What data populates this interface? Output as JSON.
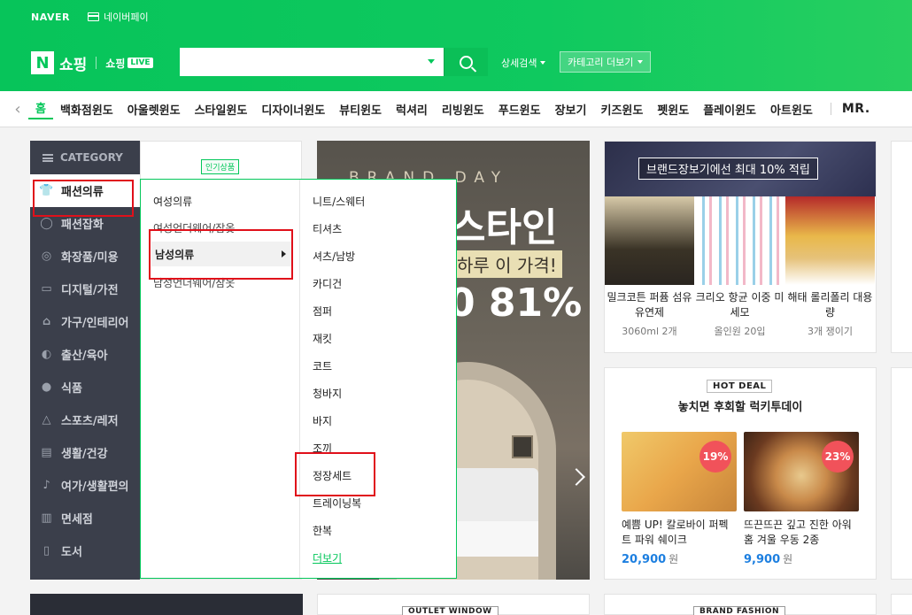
{
  "topbar": {
    "naver": "NAVER",
    "npay": "네이버페이"
  },
  "logo": {
    "n": "N",
    "shop": "쇼핑",
    "shoplive": "쇼핑",
    "live": "LIVE"
  },
  "search": {
    "value": "",
    "button": "search"
  },
  "header_links": {
    "detail": "상세검색",
    "category_more": "카테고리 더보기"
  },
  "nav": {
    "items": [
      "홈",
      "백화점윈도",
      "아울렛윈도",
      "스타일윈도",
      "디자이너윈도",
      "뷰티윈도",
      "럭셔리",
      "리빙윈도",
      "푸드윈도",
      "장보기",
      "키즈윈도",
      "펫윈도",
      "플레이윈도",
      "아트윈도"
    ],
    "mr": "MR."
  },
  "category": {
    "header": "CATEGORY",
    "items": [
      {
        "label": "패션의류",
        "icon": "shirt-icon"
      },
      {
        "label": "패션잡화",
        "icon": "ring-icon"
      },
      {
        "label": "화장품/미용",
        "icon": "mirror-icon"
      },
      {
        "label": "디지털/가전",
        "icon": "monitor-icon"
      },
      {
        "label": "가구/인테리어",
        "icon": "lamp-icon"
      },
      {
        "label": "출산/육아",
        "icon": "duck-icon"
      },
      {
        "label": "식품",
        "icon": "apple-icon"
      },
      {
        "label": "스포츠/레저",
        "icon": "tent-icon"
      },
      {
        "label": "생활/건강",
        "icon": "basket-icon"
      },
      {
        "label": "여가/생활편의",
        "icon": "guitar-icon"
      },
      {
        "label": "면세점",
        "icon": "building-icon"
      },
      {
        "label": "도서",
        "icon": "book-icon"
      }
    ]
  },
  "subpanel": {
    "badge": "인기상품"
  },
  "flyout": {
    "left": [
      "여성의류",
      "여성언더웨어/잠옷",
      "남성의류",
      "남성언더웨어/잠옷"
    ],
    "right": [
      "니트/스웨터",
      "티셔츠",
      "셔츠/남방",
      "카디건",
      "점퍼",
      "재킷",
      "코트",
      "청바지",
      "바지",
      "조끼",
      "정장세트",
      "트레이닝복",
      "한복"
    ],
    "more": "더보기"
  },
  "banner": {
    "brand_day": "BRAND DAY",
    "title": "스타인",
    "tagline": "하루 이 가격!",
    "pct": "0 81%"
  },
  "brand_card": {
    "caption": "브랜드장보기에선 최대 10% 적립",
    "products": [
      {
        "name": "밀크코튼 퍼퓸 섬유유연제",
        "sub": "3060ml 2개"
      },
      {
        "name": "크리오 항균 이중 미세모",
        "sub": "올인원 20입"
      },
      {
        "name": "해태 롤리폴리 대용량",
        "sub": "3개 쟁이기"
      }
    ]
  },
  "deal_card": {
    "badge": "HOT DEAL",
    "title": "놓치면 후회할 럭키투데이",
    "deals": [
      {
        "name": "예쁨 UP! 칼로바이 퍼펙트 파워 쉐이크",
        "price": "20,900",
        "unit": "원",
        "pct": "19%"
      },
      {
        "name": "뜨끈뜨끈 깊고 진한 아워홈 겨울 우동 2종",
        "price": "9,900",
        "unit": "원",
        "pct": "23%"
      }
    ]
  },
  "bottom": {
    "outlet": "OUTLET WINDOW",
    "brand_fashion": "BRAND FASHION"
  },
  "colors": {
    "accent": "#03c75a",
    "highlight": "#e0101a",
    "price": "#1d7fe0"
  }
}
